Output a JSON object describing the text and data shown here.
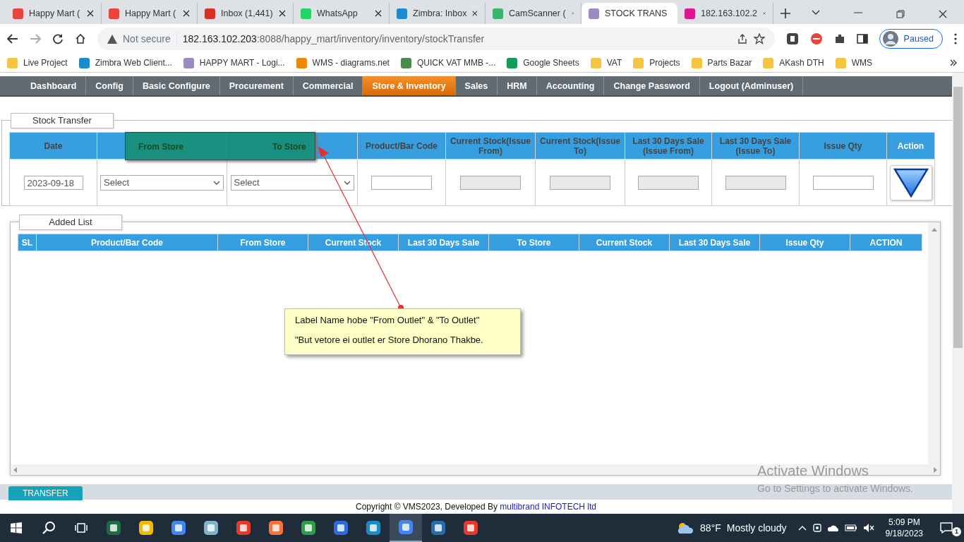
{
  "browser": {
    "tabs": [
      {
        "title": "Happy Mart (",
        "selected": false,
        "color": "#e8453c"
      },
      {
        "title": "Happy Mart (",
        "selected": false,
        "color": "#e8453c"
      },
      {
        "title": "Inbox (1,441)",
        "selected": false,
        "color": "#d93025"
      },
      {
        "title": "WhatsApp",
        "selected": false,
        "color": "#25d366"
      },
      {
        "title": "Zimbra: Inbox",
        "selected": false,
        "color": "#1a8ccc"
      },
      {
        "title": "CamScanner (",
        "selected": false,
        "color": "#3cb371"
      },
      {
        "title": "STOCK TRANS",
        "selected": true,
        "color": "#9a8bc4"
      },
      {
        "title": "182.163.102.2",
        "selected": false,
        "color": "#e0148c"
      }
    ],
    "security": "Not secure",
    "url_host": "182.163.102.203",
    "url_rest": ":8088/happy_mart/inventory/inventory/stockTransfer",
    "profile": "Paused",
    "bookmarks": [
      {
        "label": "Live Project",
        "color": "#f5c542"
      },
      {
        "label": "Zimbra Web Client...",
        "color": "#1a8ccc"
      },
      {
        "label": "HAPPY MART - Logi...",
        "color": "#9a8bc4"
      },
      {
        "label": "WMS - diagrams.net",
        "color": "#f08705"
      },
      {
        "label": "QUICK VAT MMB -...",
        "color": "#4a8a4a"
      },
      {
        "label": "Google Sheets",
        "color": "#0f9d58"
      },
      {
        "label": "VAT",
        "color": "#f5c542"
      },
      {
        "label": "Projects",
        "color": "#f5c542"
      },
      {
        "label": "Parts Bazar",
        "color": "#f5c542"
      },
      {
        "label": "AKash DTH",
        "color": "#f5c542"
      },
      {
        "label": "WMS",
        "color": "#f5c542"
      }
    ]
  },
  "menu": [
    {
      "label": "Dashboard",
      "selected": false
    },
    {
      "label": "Config",
      "selected": false
    },
    {
      "label": "Basic Configure",
      "selected": false
    },
    {
      "label": "Procurement",
      "selected": false
    },
    {
      "label": "Commercial",
      "selected": false
    },
    {
      "label": "Store & Inventory",
      "selected": true
    },
    {
      "label": "Sales",
      "selected": false
    },
    {
      "label": "HRM",
      "selected": false
    },
    {
      "label": "Accounting",
      "selected": false
    },
    {
      "label": "Change Password",
      "selected": false
    },
    {
      "label": "Logout (Adminuser)",
      "selected": false
    }
  ],
  "stock_transfer": {
    "legend": "Stock Transfer",
    "columns": [
      "Date",
      "From Store",
      "To Store",
      "Product/Bar Code",
      "Current Stock(Issue From)",
      "Current Stock(Issue To)",
      "Last 30 Days Sale (Issue From)",
      "Last 30 Days Sale (Issue To)",
      "Issue Qty",
      "Action"
    ],
    "fields": [
      {
        "kind": "date",
        "value": "2023-09-18"
      },
      {
        "kind": "select",
        "value": "Select"
      },
      {
        "kind": "select",
        "value": "Select"
      },
      {
        "kind": "text"
      },
      {
        "kind": "readonly"
      },
      {
        "kind": "readonly"
      },
      {
        "kind": "readonly"
      },
      {
        "kind": "readonly"
      },
      {
        "kind": "text"
      },
      {
        "kind": "add"
      }
    ]
  },
  "added_list": {
    "legend": "Added List",
    "columns": [
      "SL",
      "Product/Bar Code",
      "From Store",
      "Current Stock",
      "Last 30 Days Sale",
      "To Store",
      "Current Stock",
      "Last 30 Days Sale",
      "Issue Qty",
      "ACTION"
    ]
  },
  "transfer_button": "TRANSFER",
  "footer": {
    "text": "Copyright © VMS2023, Developed By ",
    "link": "multibrand INFOTECH ltd"
  },
  "annotation": {
    "lines": [
      "Label Name hobe \"From Outlet\" & \"To Outlet\"",
      "\"But vetore ei outlet er Store Dhorano Thakbe."
    ]
  },
  "activation": {
    "title": "Activate Windows",
    "subtitle": "Go to Settings to activate Windows."
  },
  "taskbar": {
    "apps": [
      {
        "color": "#1d6f42",
        "selected": false
      },
      {
        "color": "#f5b800",
        "selected": false
      },
      {
        "color": "#4285f4",
        "selected": false
      },
      {
        "color": "#7fb3c8",
        "selected": false
      },
      {
        "color": "#e8392b",
        "selected": false
      },
      {
        "color": "#ff7139",
        "selected": false
      },
      {
        "color": "#2e9e4a",
        "selected": false
      },
      {
        "color": "#2b6de0",
        "selected": false
      },
      {
        "color": "#1a8ccc",
        "selected": false
      },
      {
        "color": "#4285f4",
        "selected": true
      },
      {
        "color": "#2a6bb0",
        "selected": false
      },
      {
        "color": "#e8392b",
        "selected": false
      }
    ],
    "temperature": "88°F",
    "weather": "Mostly cloudy",
    "time": "5:09 PM",
    "date": "9/18/2023",
    "notifications": "1"
  }
}
